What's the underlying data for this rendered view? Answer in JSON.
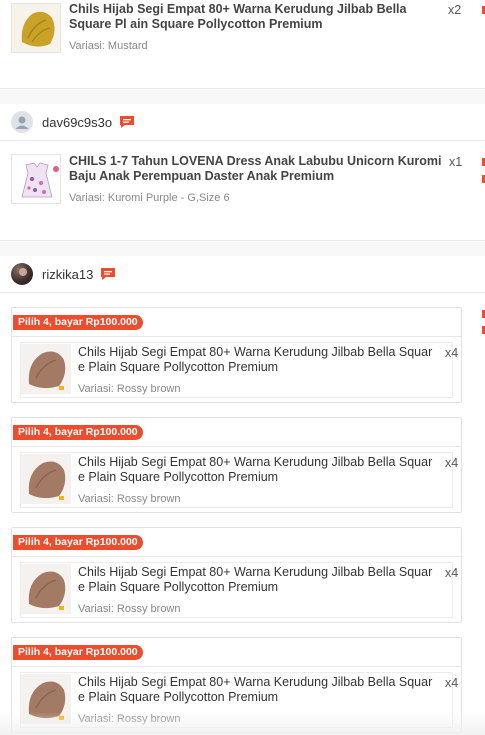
{
  "orders": [
    {
      "product": {
        "title": "Chils Hijab Segi Empat 80+ Warna Kerudung Jilbab Bella Square Pl ain Square Pollycotton Premium",
        "variant": "Variasi: Mustard",
        "qty": "x2"
      }
    },
    {
      "shop": {
        "name": "dav69c9s3o",
        "avatar_icon": "default-user-icon",
        "chat_icon": "chat-icon"
      },
      "product": {
        "title": "CHILS 1-7 Tahun LOVENA Dress Anak Labubu Unicorn Kuromi Baju Anak Perempuan Daster Anak Premium",
        "variant": "Variasi: Kuromi Purple - G,Size 6",
        "qty": "x1"
      }
    },
    {
      "shop": {
        "name": "rizkika13",
        "avatar_icon": "profile-photo",
        "chat_icon": "chat-icon"
      },
      "bundles": [
        {
          "promo": "Pilih 4, bayar Rp100.000",
          "title": "Chils Hijab Segi Empat 80+ Warna Kerudung Jilbab Bella Squar e Plain Square Pollycotton Premium",
          "variant": "Variasi: Rossy brown",
          "qty": "x4"
        },
        {
          "promo": "Pilih 4, bayar Rp100.000",
          "title": "Chils Hijab Segi Empat 80+ Warna Kerudung Jilbab Bella Squar e Plain Square Pollycotton Premium",
          "variant": "Variasi: Rossy brown",
          "qty": "x4"
        },
        {
          "promo": "Pilih 4, bayar Rp100.000",
          "title": "Chils Hijab Segi Empat 80+ Warna Kerudung Jilbab Bella Squar e Plain Square Pollycotton Premium",
          "variant": "Variasi: Rossy brown",
          "qty": "x4"
        },
        {
          "promo": "Pilih 4, bayar Rp100.000",
          "title": "Chils Hijab Segi Empat 80+ Warna Kerudung Jilbab Bella Squar e Plain Square Pollycotton Premium",
          "variant": "Variasi: Rossy brown",
          "qty": "x4"
        }
      ]
    }
  ],
  "colors": {
    "accent": "#ee4d2d",
    "mustard": "#c9a227",
    "rossy_brown": "#a37a63"
  }
}
